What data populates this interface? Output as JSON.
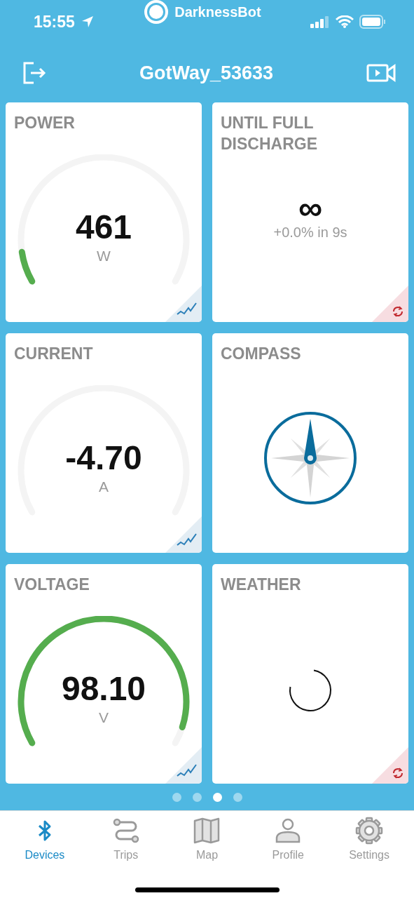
{
  "status_bar": {
    "time": "15:55",
    "app_name": "DarknessBot"
  },
  "header": {
    "title": "GotWay_53633"
  },
  "tiles": [
    {
      "kind": "gauge",
      "title": "POWER",
      "value": "461",
      "unit": "W"
    },
    {
      "kind": "info",
      "title": "UNTIL FULL DISCHARGE",
      "value": "∞",
      "detail": "+0.0% in 9s"
    },
    {
      "kind": "gauge",
      "title": "CURRENT",
      "value": "-4.70",
      "unit": "A"
    },
    {
      "kind": "compass",
      "title": "COMPASS"
    },
    {
      "kind": "gauge",
      "title": "VOLTAGE",
      "value": "98.10",
      "unit": "V"
    },
    {
      "kind": "weather",
      "title": "WEATHER"
    }
  ],
  "pages": [
    {
      "selected": false
    },
    {
      "selected": false
    },
    {
      "selected": true
    },
    {
      "selected": false
    }
  ],
  "tabs": [
    {
      "label": "Devices",
      "kind": "bluetooth",
      "selected": true
    },
    {
      "label": "Trips",
      "kind": "route",
      "selected": false
    },
    {
      "label": "Map",
      "kind": "map",
      "selected": false
    },
    {
      "label": "Profile",
      "kind": "person",
      "selected": false
    },
    {
      "label": "Settings",
      "kind": "gear",
      "selected": false
    }
  ]
}
